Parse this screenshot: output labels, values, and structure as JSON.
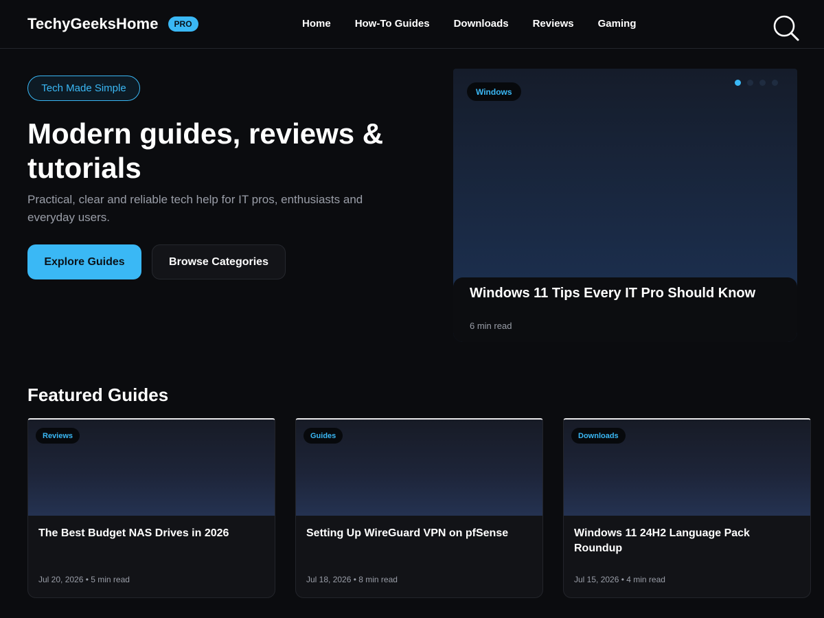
{
  "header": {
    "brand": "TechyGeeksHome",
    "badge": "PRO",
    "nav": [
      "Home",
      "How-To Guides",
      "Downloads",
      "Reviews",
      "Gaming"
    ],
    "search_icon": "search-icon"
  },
  "hero": {
    "pill": "Tech Made Simple",
    "title": "Modern guides, reviews & tutorials",
    "subtitle": "Practical, clear and reliable tech help for IT pros, enthusiasts and everyday users.",
    "primary_button": "Explore Guides",
    "secondary_button": "Browse Categories"
  },
  "slider": {
    "tag": "Windows",
    "title": "Windows 11 Tips Every IT Pro Should Know",
    "meta": "6 min read",
    "dots": {
      "count": 4,
      "active": 0
    }
  },
  "featured": {
    "heading": "Featured Guides",
    "cards": [
      {
        "tag": "Reviews",
        "title": "The Best Budget NAS Drives in 2026",
        "meta": "Jul 20, 2026 • 5 min read"
      },
      {
        "tag": "Guides",
        "title": "Setting Up WireGuard VPN on pfSense",
        "meta": "Jul 18, 2026 • 8 min read"
      },
      {
        "tag": "Downloads",
        "title": "Windows 11 24H2 Language Pack Roundup",
        "meta": "Jul 15, 2026 • 4 min read"
      }
    ]
  },
  "colors": {
    "accent": "#3ab8f5",
    "background": "#0b0c0f",
    "card": "#121317",
    "muted_text": "#9a9ea8"
  }
}
